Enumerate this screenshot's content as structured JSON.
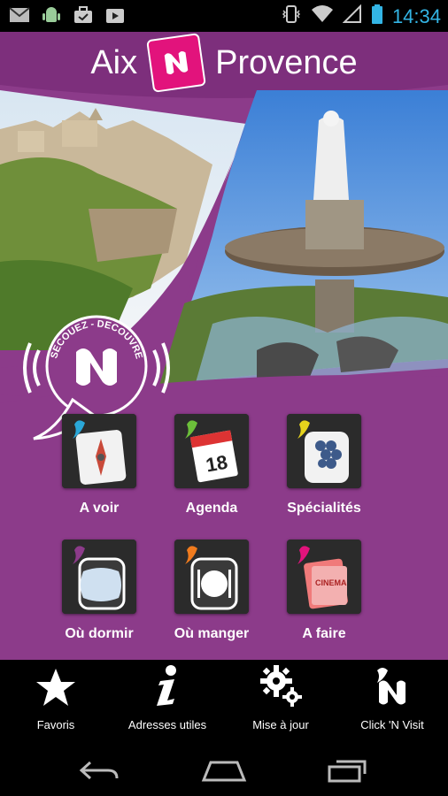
{
  "status_bar": {
    "time": "14:34",
    "left_icons": [
      "gmail-icon",
      "android-icon",
      "briefcase-icon",
      "play-store-icon"
    ],
    "right_icons": [
      "vibrate-icon",
      "wifi-icon",
      "signal-icon",
      "battery-icon"
    ]
  },
  "header": {
    "title_left": "Aix",
    "title_right": "Provence"
  },
  "shake_badge": {
    "text": "SECOUEZ - DECOUVREZ"
  },
  "tiles": [
    {
      "label": "A voir",
      "accent": "#2aa7d8",
      "icon": "compass-map-icon"
    },
    {
      "label": "Agenda",
      "accent": "#6cbf3a",
      "icon": "calendar-icon",
      "calendar_day": "18"
    },
    {
      "label": "Spécialités",
      "accent": "#e6d31c",
      "icon": "grapes-icon"
    },
    {
      "label": "Où dormir",
      "accent": "#8c3b8a",
      "icon": "pillow-icon"
    },
    {
      "label": "Où manger",
      "accent": "#f07b1e",
      "icon": "plate-cutlery-icon"
    },
    {
      "label": "A faire",
      "accent": "#e2137c",
      "icon": "tickets-icon",
      "ticket_text": "CINEMA"
    }
  ],
  "toolbar": [
    {
      "label": "Favoris",
      "icon": "star-icon"
    },
    {
      "label": "Adresses utiles",
      "icon": "info-icon"
    },
    {
      "label": "Mise à jour",
      "icon": "gears-icon"
    },
    {
      "label": "Click 'N Visit",
      "icon": "clicknvisit-logo-icon"
    }
  ],
  "nav": [
    "back-icon",
    "home-icon",
    "recent-apps-icon"
  ],
  "colors": {
    "background_purple": "#8c3b8a",
    "brand_pink": "#e2137c",
    "status_time": "#33b5e5"
  }
}
